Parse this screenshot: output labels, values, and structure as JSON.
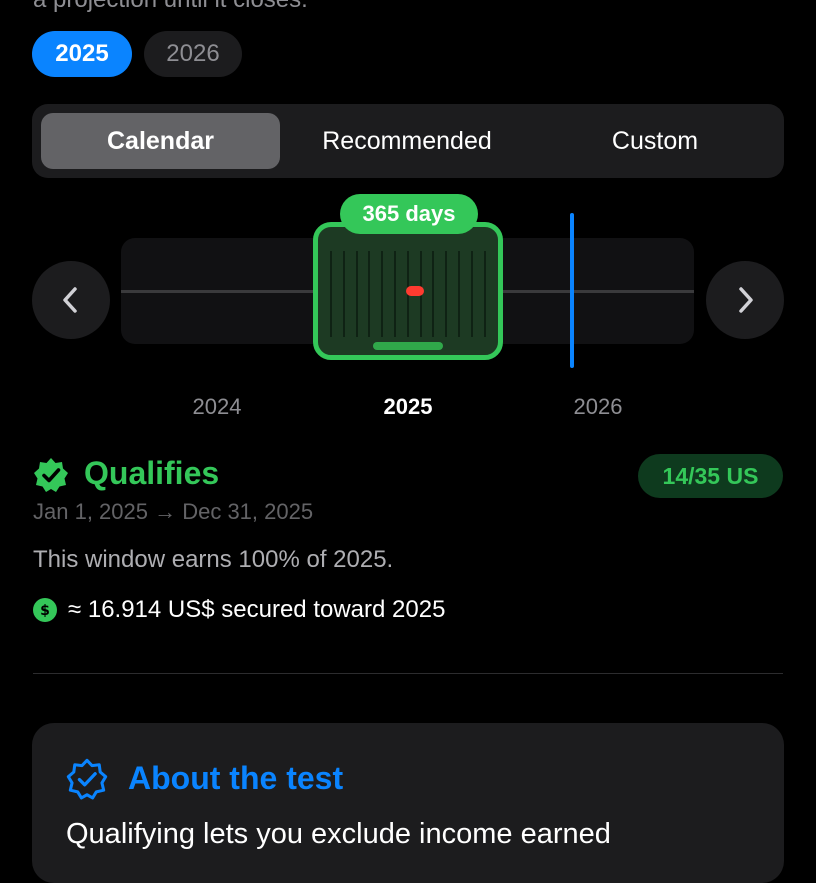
{
  "top_text": "a projection until it closes.",
  "years": [
    "2025",
    "2026"
  ],
  "modes": [
    "Calendar",
    "Recommended",
    "Custom"
  ],
  "timeline": {
    "window_length": "365 days",
    "axis_labels": [
      "2024",
      "2025",
      "2026"
    ]
  },
  "status": {
    "title": "Qualifies",
    "days_badge": "14/35 US",
    "date_range": "Jan 1, 2025 → Dec 31, 2025",
    "earn_text": "This window earns 100% of 2025.",
    "secured_text": "≈ 16.914 US$ secured toward 2025"
  },
  "about": {
    "title": "About the test",
    "body": "Qualifying lets you exclude income earned"
  },
  "icons": {
    "prev": "chevron-left-icon",
    "next": "chevron-right-icon",
    "status": "checkmark-seal-icon",
    "money": "dollar-circle-icon",
    "about": "checkmark-seal-outline-icon"
  },
  "colors": {
    "accent_blue": "#0a84ff",
    "success_green": "#34c759",
    "marker_red": "#ff3b30",
    "background": "#000000",
    "surface": "#1c1c1e"
  }
}
